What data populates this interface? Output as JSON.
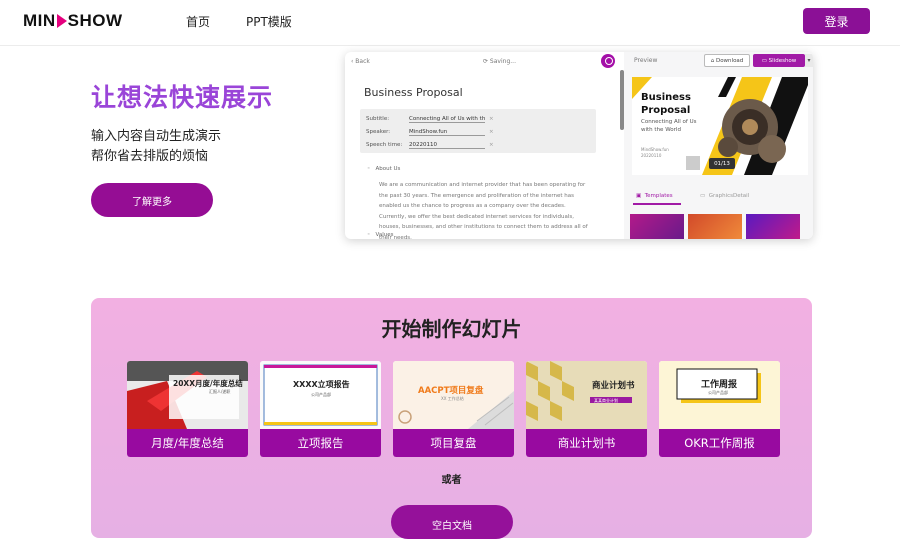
{
  "header": {
    "logo_left": "MIN",
    "logo_right": "SHOW",
    "nav": [
      "首页",
      "PPT模版"
    ],
    "login_label": "登录"
  },
  "hero": {
    "title": "让想法快速展示",
    "line1": "输入内容自动生成演示",
    "line2": "帮你省去排版的烦恼",
    "button": "了解更多"
  },
  "app_preview": {
    "back": "‹  Back",
    "saving": "⟳ Saving...",
    "doc_title": "Business Proposal",
    "fields": [
      {
        "key": "Subtitle:",
        "value": "Connecting All of Us with the World"
      },
      {
        "key": "Speaker:",
        "value": "MindShow.fun"
      },
      {
        "key": "Speech time:",
        "value": "20220110"
      }
    ],
    "about_heading": "About Us",
    "about_text": "We are a communication and internet provider that has been operating for the past 30 years. The emergence and proliferation of the internet has enabled us the chance to progress as a company over the decades. Currently, we offer the best dedicated internet services for individuals, houses, businesses, and other institutions to connect them to address all of their needs.",
    "values_heading": "Values",
    "preview_label": "Preview",
    "download": "Download",
    "slideshow": "Slideshow",
    "slide": {
      "title_line1": "Business",
      "title_line2": "Proposal",
      "sub_line1": "Connecting All of Us",
      "sub_line2": "with the World",
      "by_line1": "MindShow.fun",
      "by_line2": "20220110",
      "counter": "01/13"
    },
    "tab_templates": "Templates",
    "tab_graphics": "GraphicsDetail"
  },
  "start": {
    "title": "开始制作幻灯片",
    "templates": [
      {
        "label": "月度/年度总结",
        "img_title": "20XX月度/年度总结",
        "img_sub": "汇报人/述职"
      },
      {
        "label": "立项报告",
        "img_title": "XXXX立项报告",
        "img_sub": "公司产品部"
      },
      {
        "label": "项目复盘",
        "img_title": "AACPT项目复盘",
        "img_sub": "XX 工作总结"
      },
      {
        "label": "商业计划书",
        "img_title": "商业计划书",
        "img_sub": "某某商业计划"
      },
      {
        "label": "OKR工作周报",
        "img_title": "工作周报",
        "img_sub": "公司产品部"
      }
    ],
    "or": "或者",
    "blank_button": "空白文档"
  },
  "colors": {
    "brand_purple": "#950d94",
    "hero_title": "#9a45d8",
    "section_bg": "#f2b0e2"
  }
}
